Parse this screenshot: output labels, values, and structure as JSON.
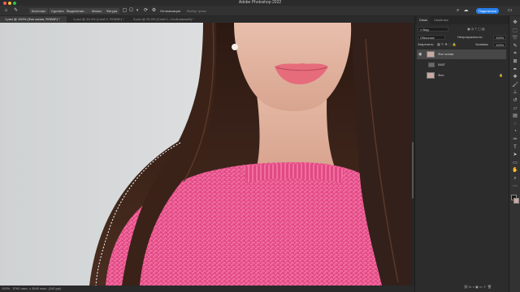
{
  "window": {
    "title": "Adobe Photoshop 2022"
  },
  "options_bar": {
    "home_icon": "home-icon",
    "tool_icon": "lasso-tool-icon",
    "crop_label": "Кисточка",
    "select_label": "Сделать",
    "selection_label": "Выделение...",
    "mask_label": "Маска",
    "shape_label": "Фигура",
    "optimize_label": "Оптимизация",
    "hint_label": "Выбор трека",
    "share_label": "Поделиться"
  },
  "tabs": [
    {
      "label": "1.psd @ 100% (Фон копия, RGB/8*) *",
      "active": true
    },
    {
      "label": "2.psd @ 33,3% (Слой 2, RGB/8*) *",
      "active": false
    },
    {
      "label": "3.psd @ 33,3% (Слой 1, Слой-маска/8) *",
      "active": false
    }
  ],
  "status_bar": {
    "zoom": "100%",
    "info": "5760 пикс. x 3840 пикс. (240 ppi)"
  },
  "layers_panel": {
    "tabs": [
      "Слои",
      "Свойства"
    ],
    "kind_filter": "Вид",
    "blend_mode": "Обычные",
    "opacity_label": "Непрозрачность:",
    "opacity_value": "100%",
    "lock_label": "Закрепить:",
    "fill_label": "Заливка:",
    "fill_value": "100%",
    "layers": [
      {
        "name": "Фон копия",
        "selected": true,
        "thumb": "#c9a9a0",
        "locked": false
      },
      {
        "name": "5487",
        "selected": false,
        "thumb": "#6b6b6b",
        "locked": false,
        "group": true
      },
      {
        "name": "Фон",
        "selected": false,
        "thumb": "#c9a9a0",
        "locked": true
      }
    ]
  },
  "toolbar": {
    "tools": [
      "move-tool-icon",
      "marquee-tool-icon",
      "lasso-tool-icon",
      "quick-select-tool-icon",
      "crop-tool-icon",
      "frame-tool-icon",
      "eyedropper-tool-icon",
      "healing-tool-icon",
      "brush-tool-icon",
      "clone-stamp-tool-icon",
      "history-brush-tool-icon",
      "eraser-tool-icon",
      "gradient-tool-icon",
      "blur-tool-icon",
      "dodge-tool-icon",
      "pen-tool-icon",
      "type-tool-icon",
      "path-select-tool-icon",
      "rectangle-tool-icon",
      "hand-tool-icon",
      "zoom-tool-icon",
      "more-tools-icon"
    ],
    "foreground_color": "#1b1b1b",
    "background_color": "#c9a99a"
  },
  "colors": {
    "accent": "#2680eb",
    "sweater": "#e6508a",
    "hair": "#3a2218",
    "skin": "#e4b8a4",
    "backdrop": "#d3d6d7"
  }
}
